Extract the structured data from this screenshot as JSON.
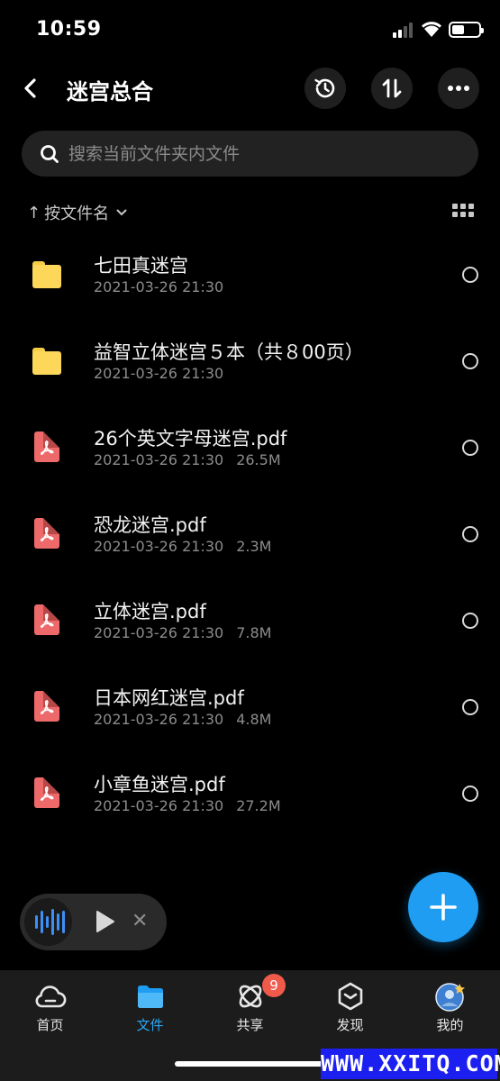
{
  "status_bar": {
    "time": "10:59"
  },
  "header": {
    "title": "迷宫总合"
  },
  "search": {
    "placeholder": "搜索当前文件夹内文件"
  },
  "sort": {
    "label": "按文件名"
  },
  "files": [
    {
      "type": "folder",
      "name": "七田真迷宫",
      "date": "2021-03-26 21:30",
      "size": ""
    },
    {
      "type": "folder",
      "name": "益智立体迷宫５本（共８00页）",
      "date": "2021-03-26 21:30",
      "size": ""
    },
    {
      "type": "pdf",
      "name": "26个英文字母迷宫.pdf",
      "date": "2021-03-26 21:30",
      "size": "26.5M"
    },
    {
      "type": "pdf",
      "name": "恐龙迷宫.pdf",
      "date": "2021-03-26 21:30",
      "size": "2.3M"
    },
    {
      "type": "pdf",
      "name": "立体迷宫.pdf",
      "date": "2021-03-26 21:30",
      "size": "7.8M"
    },
    {
      "type": "pdf",
      "name": "日本网红迷宫.pdf",
      "date": "2021-03-26 21:30",
      "size": "4.8M"
    },
    {
      "type": "pdf",
      "name": "小章鱼迷宫.pdf",
      "date": "2021-03-26 21:30",
      "size": "27.2M"
    }
  ],
  "tabs": [
    {
      "label": "首页",
      "icon": "cloud-icon"
    },
    {
      "label": "文件",
      "icon": "folder-icon"
    },
    {
      "label": "共享",
      "icon": "atom-icon"
    },
    {
      "label": "发现",
      "icon": "cube-icon"
    },
    {
      "label": "我的",
      "icon": "avatar"
    }
  ],
  "share_badge": "9",
  "watermark": "WWW.XXITQ.COM",
  "colors": {
    "accent": "#1e9df2",
    "folder": "#fcd75a",
    "pdf": "#ee6a6a",
    "badge": "#f05a4b"
  }
}
